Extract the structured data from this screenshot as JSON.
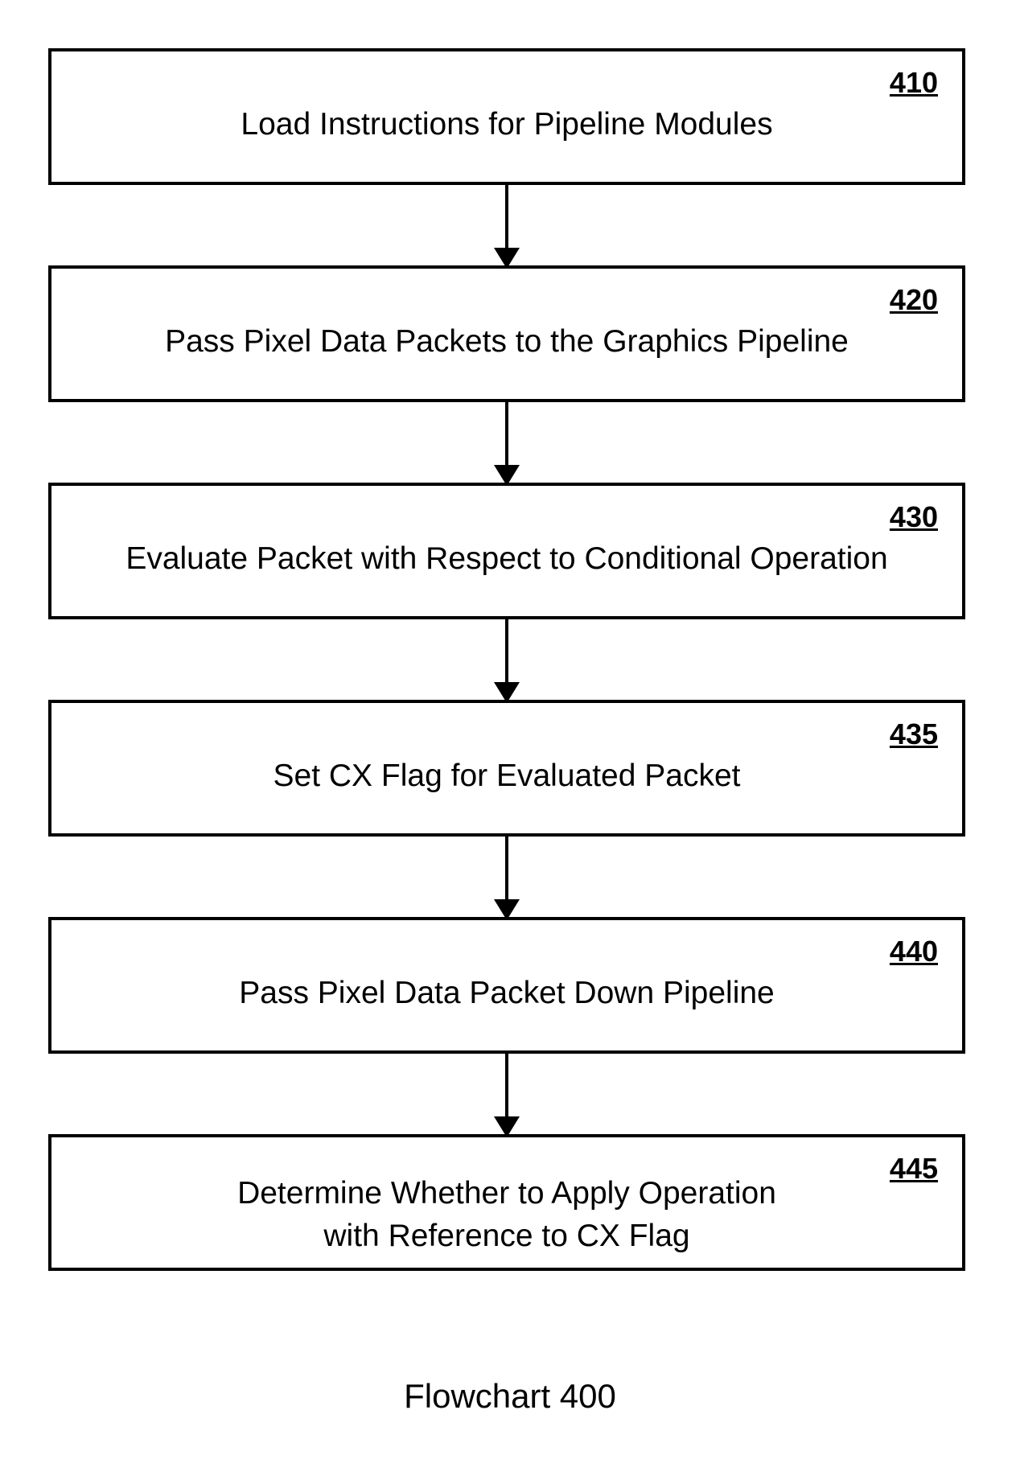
{
  "flowchart": {
    "caption": "Flowchart 400",
    "steps": [
      {
        "number": "410",
        "text": "Load Instructions for Pipeline Modules"
      },
      {
        "number": "420",
        "text": "Pass Pixel Data Packets to the Graphics Pipeline"
      },
      {
        "number": "430",
        "text": "Evaluate Packet with Respect to Conditional Operation"
      },
      {
        "number": "435",
        "text": "Set CX Flag for Evaluated Packet"
      },
      {
        "number": "440",
        "text": "Pass Pixel Data Packet Down Pipeline"
      },
      {
        "number": "445",
        "text_line1": "Determine Whether to Apply Operation",
        "text_line2": "with Reference to CX Flag"
      }
    ]
  }
}
